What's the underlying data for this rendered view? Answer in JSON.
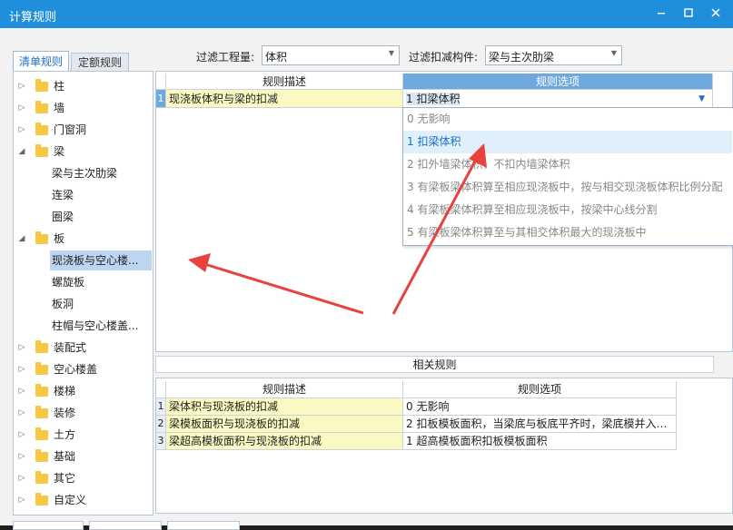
{
  "window": {
    "title": "计算规则",
    "minimize_icon": "minimize-icon",
    "maximize_icon": "maximize-icon",
    "close_icon": "close-icon"
  },
  "tabs": [
    {
      "label": "清单规则",
      "active": true
    },
    {
      "label": "定额规则",
      "active": false
    }
  ],
  "filters": {
    "quantity_label": "过滤工程量:",
    "quantity_value": "体积",
    "component_label": "过滤扣减构件:",
    "component_value": "梁与主次肋梁"
  },
  "tree": [
    {
      "label": "柱",
      "level": 0,
      "expanded": false
    },
    {
      "label": "墙",
      "level": 0,
      "expanded": false
    },
    {
      "label": "门窗洞",
      "level": 0,
      "expanded": false
    },
    {
      "label": "梁",
      "level": 0,
      "expanded": true
    },
    {
      "label": "梁与主次肋梁",
      "level": 1
    },
    {
      "label": "连梁",
      "level": 1
    },
    {
      "label": "圈梁",
      "level": 1
    },
    {
      "label": "板",
      "level": 0,
      "expanded": true
    },
    {
      "label": "现浇板与空心楼...",
      "level": 1,
      "selected": true
    },
    {
      "label": "螺旋板",
      "level": 1
    },
    {
      "label": "板洞",
      "level": 1
    },
    {
      "label": "柱帽与空心楼盖...",
      "level": 1
    },
    {
      "label": "装配式",
      "level": 0,
      "expanded": false
    },
    {
      "label": "空心楼盖",
      "level": 0,
      "expanded": false
    },
    {
      "label": "楼梯",
      "level": 0,
      "expanded": false
    },
    {
      "label": "装修",
      "level": 0,
      "expanded": false
    },
    {
      "label": "土方",
      "level": 0,
      "expanded": false
    },
    {
      "label": "基础",
      "level": 0,
      "expanded": false
    },
    {
      "label": "其它",
      "level": 0,
      "expanded": false
    },
    {
      "label": "自定义",
      "level": 0,
      "expanded": false
    }
  ],
  "rules_table": {
    "col_desc": "规则描述",
    "col_option": "规则选项",
    "rows": [
      {
        "num": "1",
        "desc": "现浇板体积与梁的扣减",
        "option": "1  扣梁体积"
      }
    ]
  },
  "dropdown_options": [
    "0  无影响",
    "1  扣梁体积",
    "2  扣外墙梁体积，不扣内墙梁体积",
    "3  有梁板梁体积算至相应现浇板中，按与相交现浇板体积比例分配",
    "4  有梁板梁体积算至相应现浇板中，按梁中心线分割",
    "5  有梁板梁体积算至与其相交体积最大的现浇板中"
  ],
  "related": {
    "title": "相关规则",
    "col_desc": "规则描述",
    "col_option": "规则选项",
    "rows": [
      {
        "num": "1",
        "desc": "梁体积与现浇板的扣减",
        "option": "0  无影响"
      },
      {
        "num": "2",
        "desc": "梁模板面积与现浇板的扣减",
        "option": "2 扣板模板面积，当梁底与板底平齐时，梁底模并入…"
      },
      {
        "num": "3",
        "desc": "梁超高模板面积与现浇板的扣减",
        "option": "1 超高模板面积扣板模板面积"
      }
    ]
  },
  "colors": {
    "titlebar": "#1f8fdc",
    "header_blue": "#6ea8df",
    "cell_yellow": "#fbf9c2",
    "annotation_arrow": "#e8423f"
  }
}
